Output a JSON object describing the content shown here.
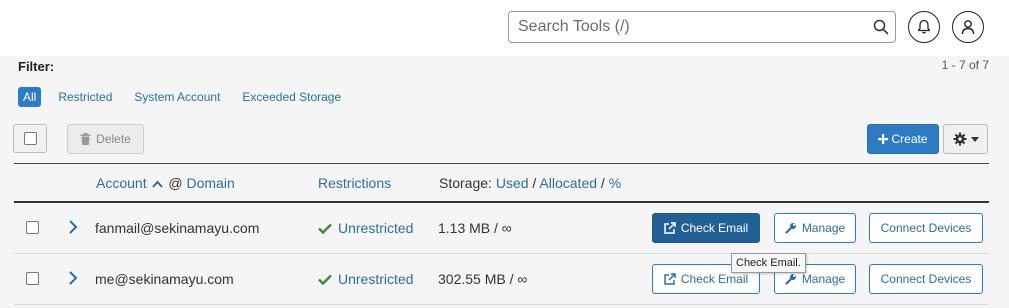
{
  "search": {
    "placeholder": "Search Tools (/)"
  },
  "header_icons": [
    "bell-icon",
    "user-icon",
    "search-icon"
  ],
  "filter": {
    "label": "Filter:",
    "pager": "1 - 7 of 7",
    "tabs": [
      {
        "label": "All",
        "active": true
      },
      {
        "label": "Restricted",
        "active": false
      },
      {
        "label": "System Account",
        "active": false
      },
      {
        "label": "Exceeded Storage",
        "active": false
      }
    ]
  },
  "toolbar": {
    "delete_label": "Delete",
    "create_label": "Create"
  },
  "table": {
    "headers": {
      "account": "Account",
      "at": "@",
      "domain": "Domain",
      "restrictions": "Restrictions",
      "storage_prefix": "Storage:",
      "used": "Used",
      "sep1": "/",
      "allocated": "Allocated",
      "sep2": "/",
      "percent": "%"
    },
    "rows": [
      {
        "email": "fanmail@sekinamayu.com",
        "restriction": "Unrestricted",
        "storage": "1.13 MB / ∞",
        "check_email": "Check Email",
        "manage": "Manage",
        "connect": "Connect Devices"
      },
      {
        "email": "me@sekinamayu.com",
        "restriction": "Unrestricted",
        "storage": "302.55 MB / ∞",
        "check_email": "Check Email",
        "manage": "Manage",
        "connect": "Connect Devices"
      }
    ]
  },
  "tooltip": "Check Email.",
  "colors": {
    "primary": "#2e7bc4",
    "link": "#2e6da4",
    "success": "#3c8a3e",
    "dark_button": "#225f94"
  }
}
